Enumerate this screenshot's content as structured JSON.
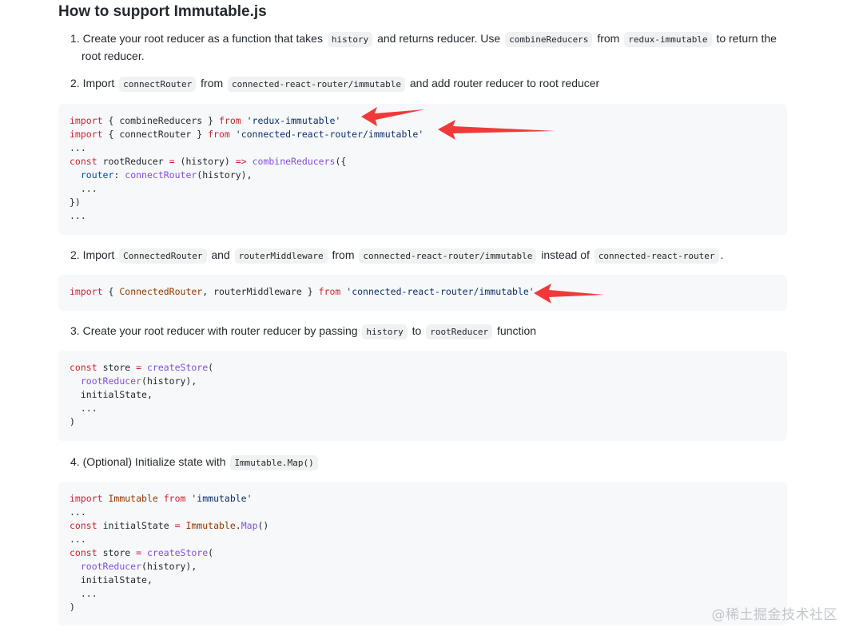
{
  "heading": "How to support Immutable.js",
  "step1": {
    "num": "1.",
    "t1": "Create your root reducer as a function that takes",
    "c1": "history",
    "t2": "and returns reducer. Use",
    "c2": "combineReducers",
    "t3": "from",
    "c3": "redux-immutable",
    "t4": "to return the",
    "t5": "root reducer."
  },
  "step2a": {
    "num": "2.",
    "t1": "Import",
    "c1": "connectRouter",
    "t2": "from",
    "c2": "connected-react-router/immutable",
    "t3": "and add router reducer to root reducer"
  },
  "code1": {
    "l1_import": "import",
    "l1_b": "{ combineReducers }",
    "l1_from": "from",
    "l1_str": "'redux-immutable'",
    "l2_import": "import",
    "l2_b": "{ connectRouter }",
    "l2_from": "from",
    "l2_str": "'connected-react-router/immutable'",
    "l3": "...",
    "l4_const": "const",
    "l4_b": "rootReducer",
    "l4_eq": "=",
    "l4_c": "(history)",
    "l4_arrow": "=>",
    "l4_fn": "combineReducers",
    "l4_d": "({",
    "l5_key": "router",
    "l5_b": ":",
    "l5_fn": "connectRouter",
    "l5_c": "(history),",
    "l6": "...",
    "l7": "})",
    "l8": "..."
  },
  "step2b": {
    "num": "2.",
    "t1": "Import",
    "c1": "ConnectedRouter",
    "t2": "and",
    "c2": "routerMiddleware",
    "t3": "from",
    "c3": "connected-react-router/immutable",
    "t4": "instead of",
    "c4": "connected-react-router",
    "t5": "."
  },
  "code2": {
    "l1_import": "import",
    "l1_a": "{",
    "l1_v": "ConnectedRouter",
    "l1_b": ", routerMiddleware }",
    "l1_from": "from",
    "l1_str": "'connected-react-router/immutable'"
  },
  "step3": {
    "num": "3.",
    "t1": "Create your root reducer with router reducer by passing",
    "c1": "history",
    "t2": "to",
    "c2": "rootReducer",
    "t3": "function"
  },
  "code3": {
    "l1_const": "const",
    "l1_b": "store",
    "l1_eq": "=",
    "l1_fn": "createStore",
    "l1_p": "(",
    "l2_fn": "rootReducer",
    "l2_b": "(history),",
    "l3": "initialState,",
    "l4": "...",
    "l5": ")"
  },
  "step4": {
    "num": "4.",
    "t1": "(Optional) Initialize state with",
    "c1": "Immutable.Map()"
  },
  "code4": {
    "l1_import": "import",
    "l1_v": "Immutable",
    "l1_from": "from",
    "l1_str": "'immutable'",
    "l2": "...",
    "l3_const": "const",
    "l3_b": "initialState",
    "l3_eq": "=",
    "l3_v": "Immutable",
    "l3_dot": ".",
    "l3_fn": "Map",
    "l3_p": "()",
    "l4": "...",
    "l5_const": "const",
    "l5_b": "store",
    "l5_eq": "=",
    "l5_fn": "createStore",
    "l5_p": "(",
    "l6_fn": "rootReducer",
    "l6_b": "(history),",
    "l7": "initialState,",
    "l8": "...",
    "l9": ")"
  },
  "watermark": "@稀土掘金技术社区",
  "colors": {
    "keyword": "#cf222e",
    "string": "#0a3069",
    "function": "#8250df",
    "variable": "#953800",
    "property": "#0550ae",
    "arrow": "#f03a3a"
  }
}
